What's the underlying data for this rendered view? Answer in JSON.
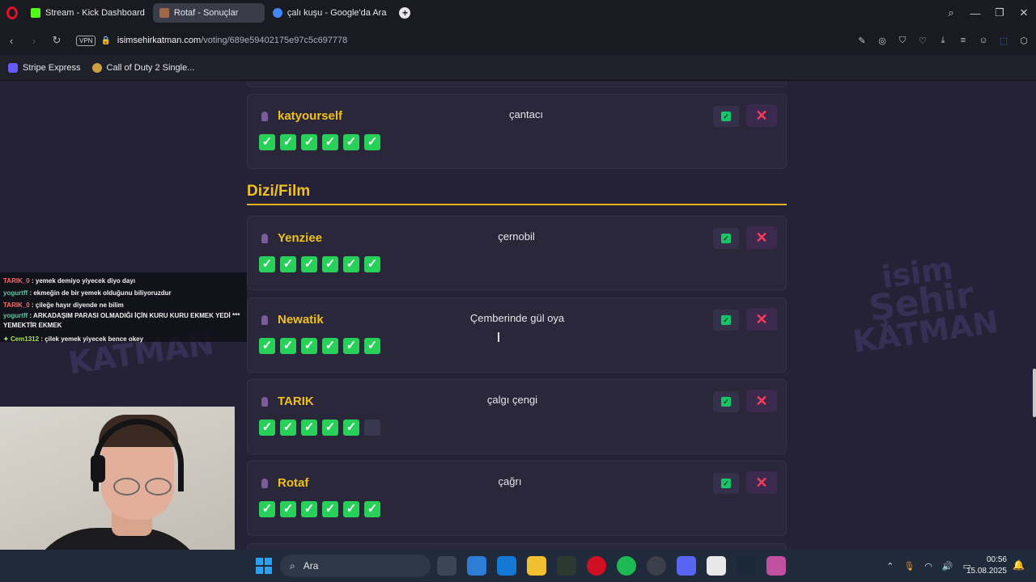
{
  "browser": {
    "tabs": [
      {
        "title": "Stream - Kick Dashboard",
        "icon": "kick-icon",
        "color": "#53fc18"
      },
      {
        "title": "Rotaf - Sonuçlar",
        "icon": "site-icon",
        "color": "#a0664a",
        "active": true
      },
      {
        "title": "çalı kuşu - Google'da Ara",
        "icon": "google-icon",
        "color": "#4285f4"
      }
    ],
    "url_host": "isimsehirkatman.com",
    "url_path": "/voting/689e59402175e97c5c697778",
    "vpn_label": "VPN",
    "bookmarks": [
      {
        "label": "Stripe Express",
        "icon": "stripe-icon",
        "color": "#635bff"
      },
      {
        "label": "Call of Duty 2 Single...",
        "icon": "cod-icon",
        "color": "#c8a040"
      }
    ]
  },
  "watermark": {
    "line1": "isim",
    "line2": "Şehir",
    "line3": "KATMAN"
  },
  "top_card": {
    "user": "katyourself",
    "answer": "çantacı",
    "votes": [
      true,
      true,
      true,
      true,
      true,
      true
    ]
  },
  "section": {
    "title": "Dizi/Film"
  },
  "answers": [
    {
      "user": "Yenziee",
      "answer": "çernobil",
      "votes": [
        true,
        true,
        true,
        true,
        true,
        true
      ]
    },
    {
      "user": "Newatik",
      "answer": "Çemberinde gül oya",
      "votes": [
        true,
        true,
        true,
        true,
        true,
        true
      ]
    },
    {
      "user": "TARIK",
      "answer": "çalgı çengi",
      "votes": [
        true,
        true,
        true,
        true,
        true,
        false
      ]
    },
    {
      "user": "Rotaf",
      "answer": "çağrı",
      "votes": [
        true,
        true,
        true,
        true,
        true,
        true
      ]
    }
  ],
  "chat": [
    {
      "user": "TARIK_0",
      "color": "#ff6a6a",
      "text": ": yemek demiyo yiyecek diyo dayı"
    },
    {
      "user": "yogurtff",
      "color": "#5ec8a0",
      "text": ": ekmeğin de bir yemek olduğunu biliyoruzdur"
    },
    {
      "user": "TARIK_0",
      "color": "#ff6a6a",
      "text": ": çileğe hayır diyende ne bilim"
    },
    {
      "user": "yogurtff",
      "color": "#5ec8a0",
      "text": ": ARKADAŞIM PARASI OLMADIĞI İÇİN KURU KURU EKMEK YEDİ *** YEMEKTİR EKMEK"
    },
    {
      "user": "Cem1312",
      "color": "#a8e060",
      "text": ": çilek yemek yiyecek bence okey"
    }
  ],
  "taskbar": {
    "search_placeholder": "Ara",
    "time": "00:56",
    "date": "15.08.2025"
  }
}
